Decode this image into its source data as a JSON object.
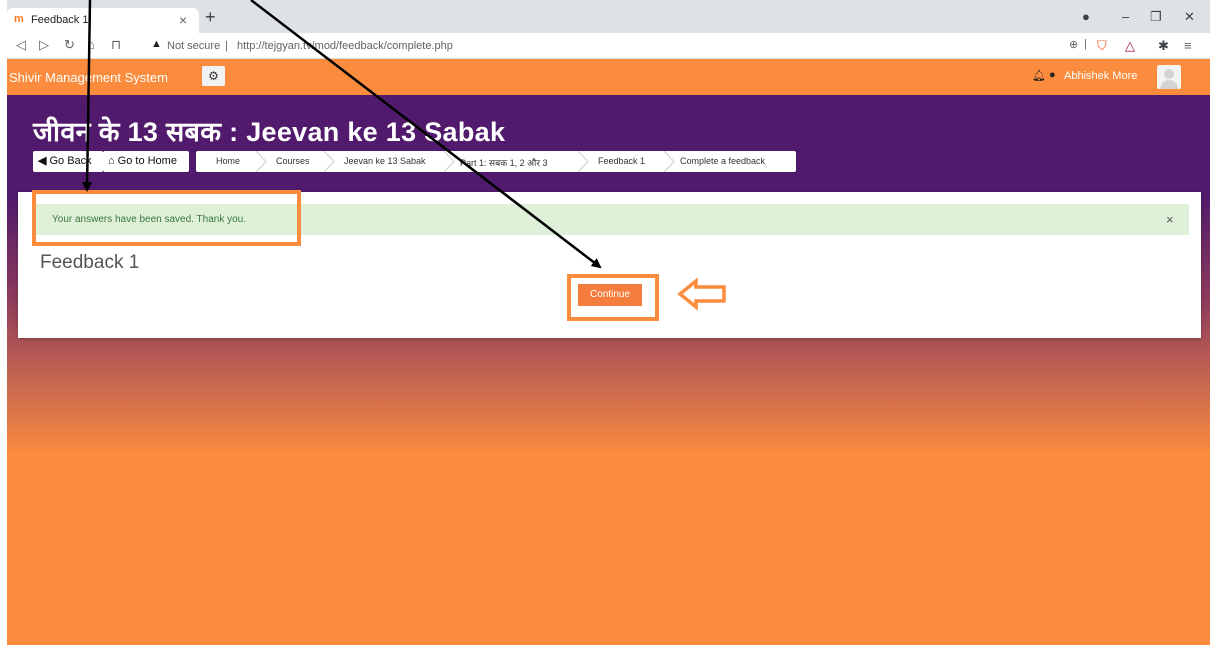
{
  "browser": {
    "tab_title": "Feedback 1",
    "tab_favicon": "m",
    "tab_close": "×",
    "new_tab": "+",
    "security_label": "Not secure",
    "url": "http://tejgyan.tv/mod/feedback/complete.php"
  },
  "navbar": {
    "brand": "Shivir Management System",
    "user_name": "Abhishek More"
  },
  "header": {
    "title": "जीवन के 13 सबक : Jeevan ke 13 Sabak",
    "go_back_label": "Go Back",
    "go_home_label": "Go to Home",
    "breadcrumb": [
      "Home",
      "Courses",
      "Jeevan ke 13 Sabak",
      "Part 1: सबक 1, 2 और 3",
      "Feedback 1",
      "Complete a feedback"
    ]
  },
  "main": {
    "alert_text": "Your answers have been saved. Thank you.",
    "alert_close": "×",
    "title": "Feedback 1",
    "continue_label": "Continue"
  },
  "colors": {
    "accent": "#fb8c3d",
    "header_purple": "#511a6c",
    "alert_bg": "#dff0d8",
    "alert_text": "#3c763d"
  },
  "icons": [
    "tab-favicon",
    "back-arrow-icon",
    "forward-arrow-icon",
    "reload-icon",
    "home-icon",
    "bookmark-icon",
    "warning-icon",
    "zoom-icon",
    "brave-shield-icon",
    "brave-rewards-icon",
    "extensions-icon",
    "menu-icon",
    "gear-icon",
    "bell-icon",
    "chat-icon",
    "avatar",
    "arrow-circle-left-icon",
    "house-icon",
    "close-icon",
    "left-arrow-annotation-icon"
  ]
}
